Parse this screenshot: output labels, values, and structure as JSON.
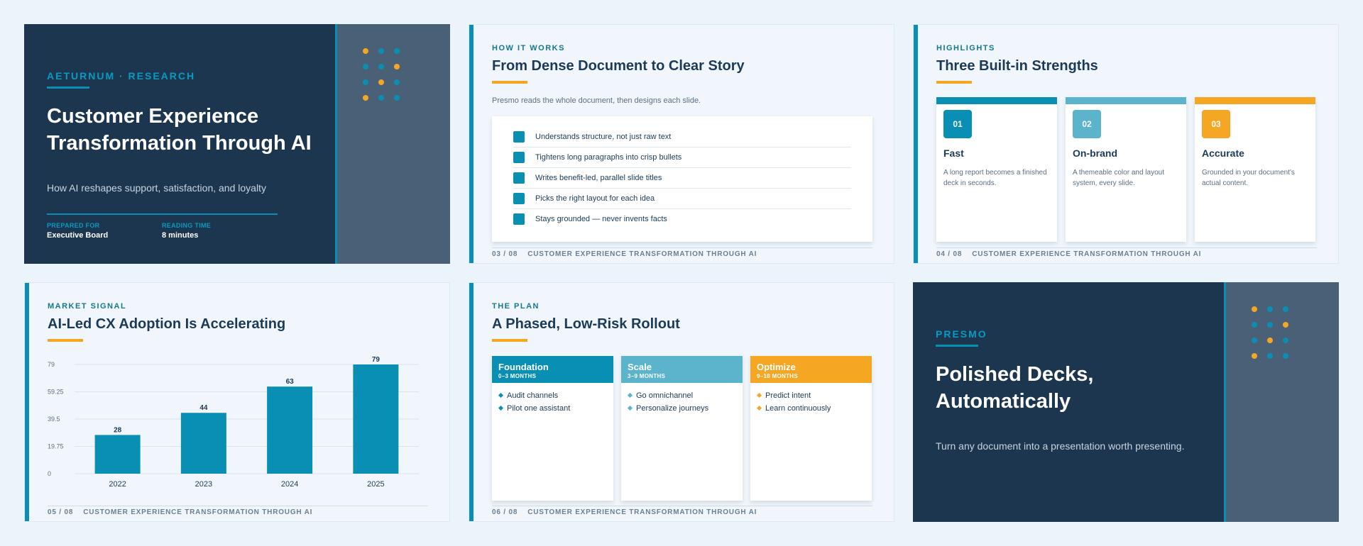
{
  "colors": {
    "teal": "#0a8fb4",
    "light_teal": "#5bb3cc",
    "orange": "#f5a623",
    "navy": "#1c3650",
    "slate": "#4a6077"
  },
  "slide1": {
    "eyebrow": "AETURNUM · RESEARCH",
    "title_line1": "Customer Experience",
    "title_line2": "Transformation Through AI",
    "subtitle": "How AI reshapes support, satisfaction, and loyalty",
    "prepared_label": "PREPARED FOR",
    "prepared_value": "Executive Board",
    "reading_label": "READING TIME",
    "reading_value": "8 minutes"
  },
  "slide2": {
    "eyebrow": "HOW IT WORKS",
    "title": "From Dense Document to Clear Story",
    "intro": "Presmo reads the whole document, then designs each slide.",
    "items": [
      "Understands structure, not just raw text",
      "Tightens long paragraphs into crisp bullets",
      "Writes benefit-led, parallel slide titles",
      "Picks the right layout for each idea",
      "Stays grounded — never invents facts"
    ],
    "footer_num": "03 / 08",
    "footer_title": "CUSTOMER EXPERIENCE TRANSFORMATION THROUGH AI"
  },
  "slide3": {
    "eyebrow": "HIGHLIGHTS",
    "title": "Three Built-in Strengths",
    "cards": [
      {
        "num": "01",
        "heading": "Fast",
        "desc": "A long report becomes a finished deck in seconds.",
        "color": "#0a8fb4"
      },
      {
        "num": "02",
        "heading": "On-brand",
        "desc": "A themeable color and layout system, every slide.",
        "color": "#5bb3cc"
      },
      {
        "num": "03",
        "heading": "Accurate",
        "desc": "Grounded in your document's actual content.",
        "color": "#f5a623"
      }
    ],
    "footer_num": "04 / 08",
    "footer_title": "CUSTOMER EXPERIENCE TRANSFORMATION THROUGH AI"
  },
  "slide4": {
    "eyebrow": "MARKET SIGNAL",
    "title": "AI-Led CX Adoption Is Accelerating",
    "footer_num": "05 / 08",
    "footer_title": "CUSTOMER EXPERIENCE TRANSFORMATION THROUGH AI"
  },
  "chart_data": {
    "type": "bar",
    "categories": [
      "2022",
      "2023",
      "2024",
      "2025"
    ],
    "values": [
      28,
      44,
      63,
      79
    ],
    "yticks": [
      "0",
      "19.75",
      "39.5",
      "59.25",
      "79"
    ],
    "ylim": [
      0,
      79
    ],
    "grid": true,
    "bar_color": "#0a8fb4"
  },
  "slide5": {
    "eyebrow": "THE PLAN",
    "title": "A Phased, Low-Risk Rollout",
    "phases": [
      {
        "name": "Foundation",
        "duration": "0–3 MONTHS",
        "items": [
          "Audit channels",
          "Pilot one assistant"
        ],
        "color": "#0a8fb4",
        "bullet": "#0a8fb4"
      },
      {
        "name": "Scale",
        "duration": "3–9 MONTHS",
        "items": [
          "Go omnichannel",
          "Personalize journeys"
        ],
        "color": "#5bb3cc",
        "bullet": "#5bb3cc"
      },
      {
        "name": "Optimize",
        "duration": "9–18 MONTHS",
        "items": [
          "Predict intent",
          "Learn continuously"
        ],
        "color": "#f5a623",
        "bullet": "#f5a623"
      }
    ],
    "footer_num": "06 / 08",
    "footer_title": "CUSTOMER EXPERIENCE TRANSFORMATION THROUGH AI"
  },
  "slide6": {
    "eyebrow": "PRESMO",
    "title_line1": "Polished Decks,",
    "title_line2": "Automatically",
    "subtitle": "Turn any document into a presentation worth presenting."
  }
}
